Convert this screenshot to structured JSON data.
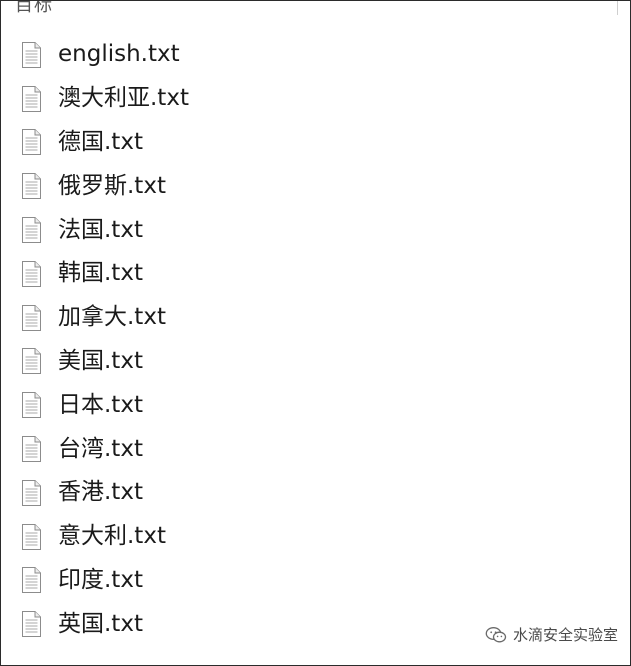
{
  "header": {
    "partial_title": "目标"
  },
  "files": [
    {
      "name": "english.txt",
      "icon": "text-file-icon"
    },
    {
      "name": "澳大利亚.txt",
      "icon": "text-file-icon"
    },
    {
      "name": "德国.txt",
      "icon": "text-file-icon"
    },
    {
      "name": "俄罗斯.txt",
      "icon": "text-file-icon"
    },
    {
      "name": "法国.txt",
      "icon": "text-file-icon"
    },
    {
      "name": "韩国.txt",
      "icon": "text-file-icon"
    },
    {
      "name": "加拿大.txt",
      "icon": "text-file-icon"
    },
    {
      "name": "美国.txt",
      "icon": "text-file-icon"
    },
    {
      "name": "日本.txt",
      "icon": "text-file-icon"
    },
    {
      "name": "台湾.txt",
      "icon": "text-file-icon"
    },
    {
      "name": "香港.txt",
      "icon": "text-file-icon"
    },
    {
      "name": "意大利.txt",
      "icon": "text-file-icon"
    },
    {
      "name": "印度.txt",
      "icon": "text-file-icon"
    },
    {
      "name": "英国.txt",
      "icon": "text-file-icon"
    }
  ],
  "watermark": {
    "text": "水滴安全实验室",
    "icon": "wechat-icon"
  }
}
